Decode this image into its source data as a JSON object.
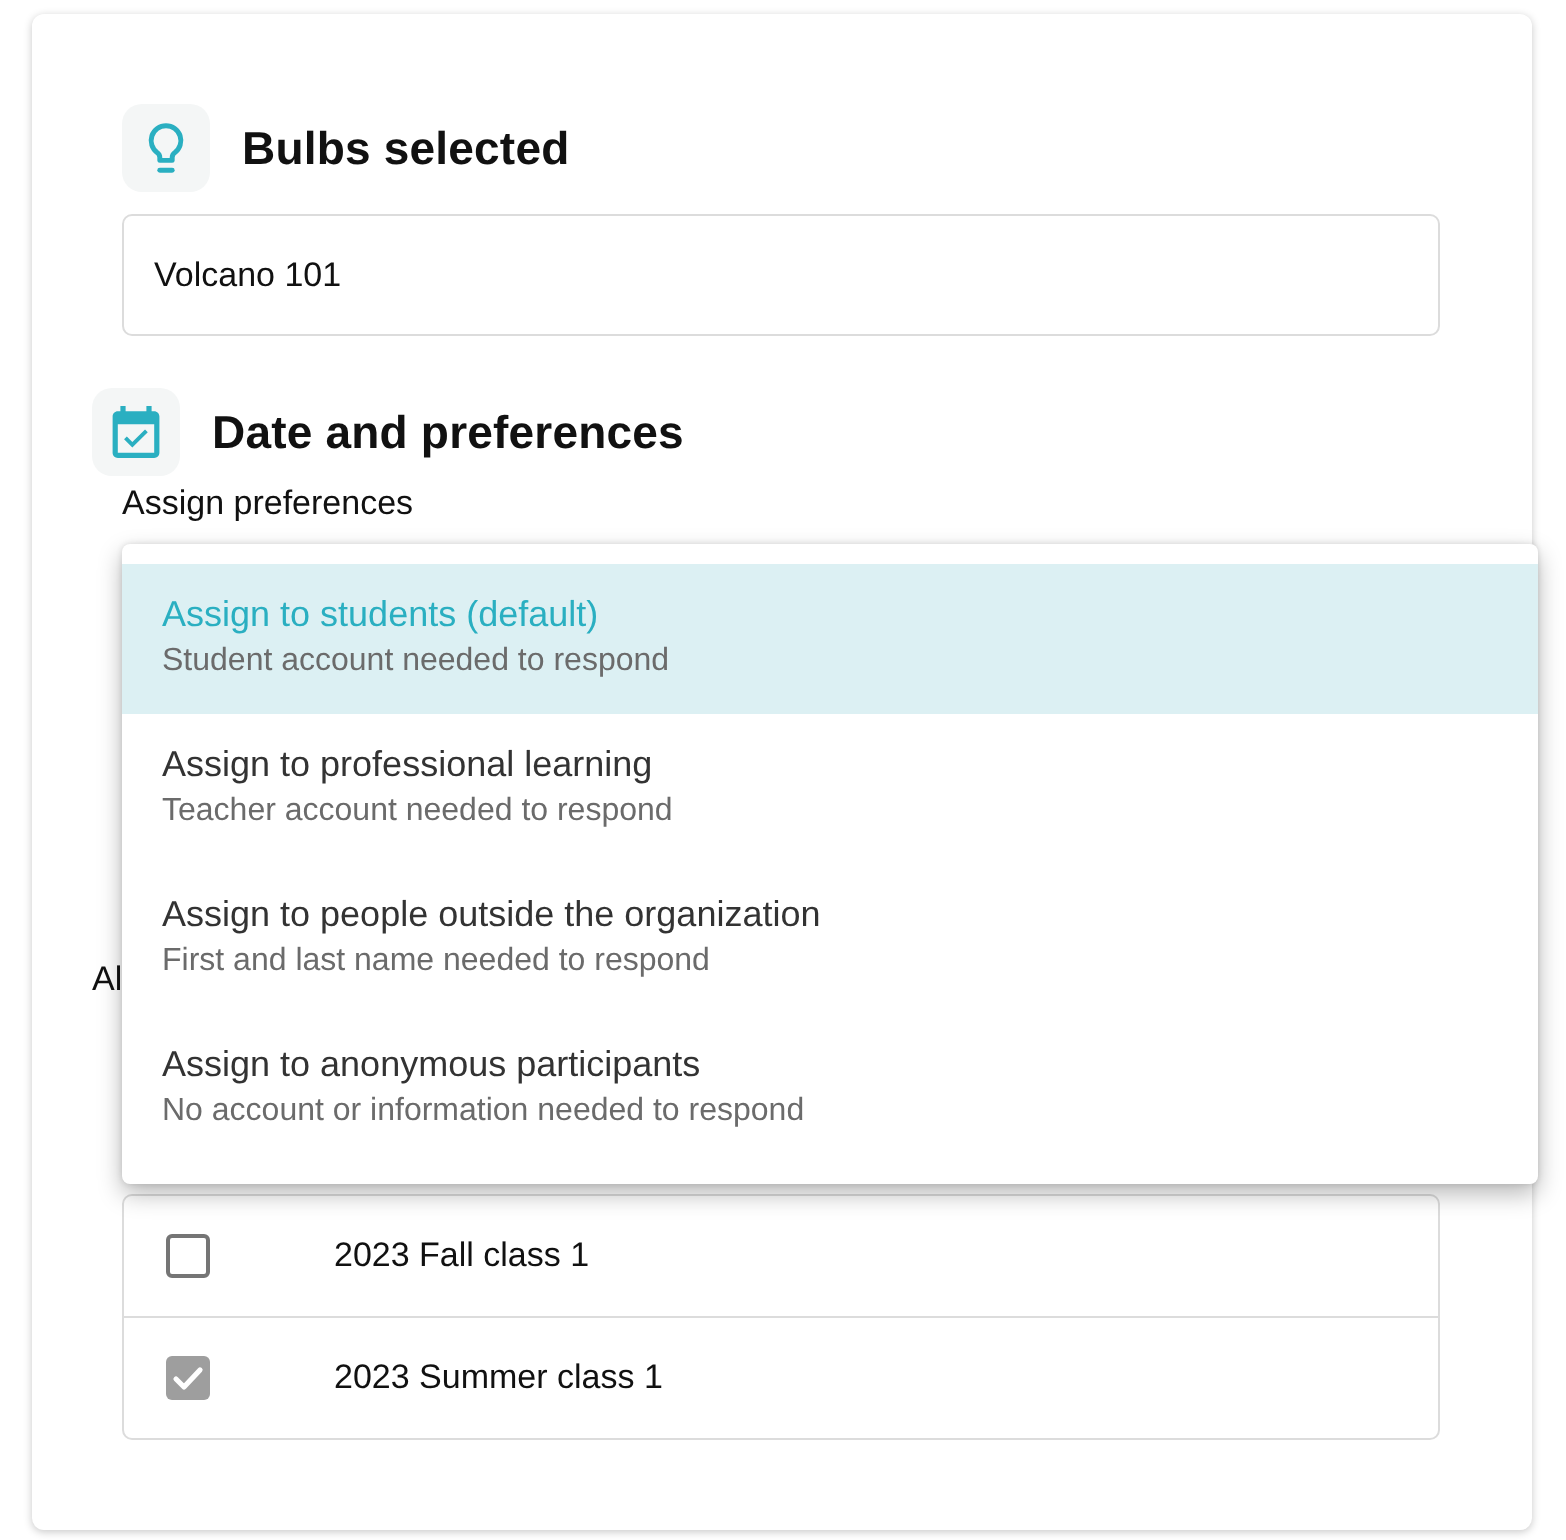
{
  "bulbs_section": {
    "title": "Bulbs selected",
    "field_value": "Volcano 101"
  },
  "date_section": {
    "title": "Date and preferences",
    "assign_label": "Assign preferences",
    "covered_label": "Al"
  },
  "assign_menu": {
    "options": [
      {
        "title": "Assign to students (default)",
        "subtitle": "Student account needed to respond",
        "selected": true
      },
      {
        "title": "Assign to professional learning",
        "subtitle": "Teacher account needed to respond",
        "selected": false
      },
      {
        "title": "Assign to people outside the organization",
        "subtitle": "First and last name needed to respond",
        "selected": false
      },
      {
        "title": "Assign to anonymous participants",
        "subtitle": "No account or information needed to respond",
        "selected": false
      }
    ]
  },
  "classes": {
    "rows": [
      {
        "name": "2023 Fall class 1",
        "checked": false,
        "disabled": false
      },
      {
        "name": "2023 Summer class 1",
        "checked": true,
        "disabled": true
      }
    ]
  }
}
